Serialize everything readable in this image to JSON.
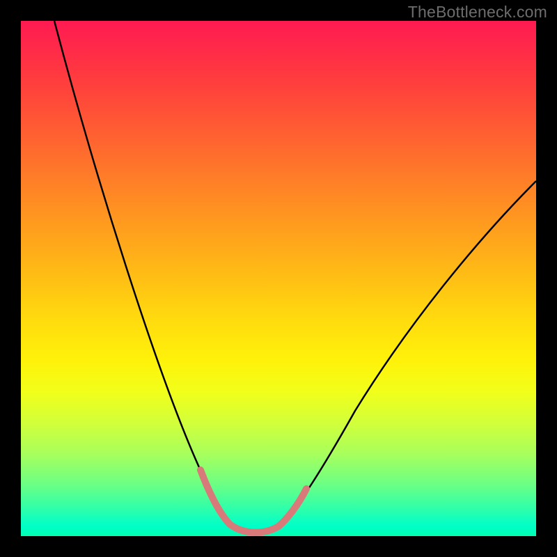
{
  "watermark": {
    "text": "TheBottleneck.com"
  },
  "colors": {
    "page_bg": "#000000",
    "curve_stroke": "#000000",
    "highlight_stroke": "#d87a7a",
    "gradient_top": "#ff1a52",
    "gradient_bottom": "#00ffb0"
  },
  "chart_data": {
    "type": "line",
    "title": "",
    "xlabel": "",
    "ylabel": "",
    "xlim": [
      0,
      100
    ],
    "ylim": [
      0,
      100
    ],
    "grid": false,
    "legend": null,
    "annotations": [],
    "series": [
      {
        "name": "bottleneck-curve",
        "x": [
          0,
          5,
          10,
          15,
          20,
          25,
          30,
          32,
          35,
          38,
          40,
          42,
          45,
          48,
          50,
          55,
          60,
          65,
          70,
          75,
          80,
          85,
          90,
          95,
          100
        ],
        "y": [
          100,
          88,
          76,
          65,
          54,
          43,
          29,
          21,
          12,
          6,
          3,
          1,
          0.5,
          0.8,
          2,
          7,
          15,
          24,
          33,
          41,
          48,
          55,
          62,
          68,
          73
        ]
      },
      {
        "name": "optimal-region-highlight",
        "x": [
          35,
          37,
          39,
          41,
          43,
          45,
          47,
          49,
          51,
          53
        ],
        "y": [
          12,
          8,
          5,
          2.5,
          1,
          0.5,
          0.8,
          2,
          4,
          7
        ]
      }
    ]
  }
}
